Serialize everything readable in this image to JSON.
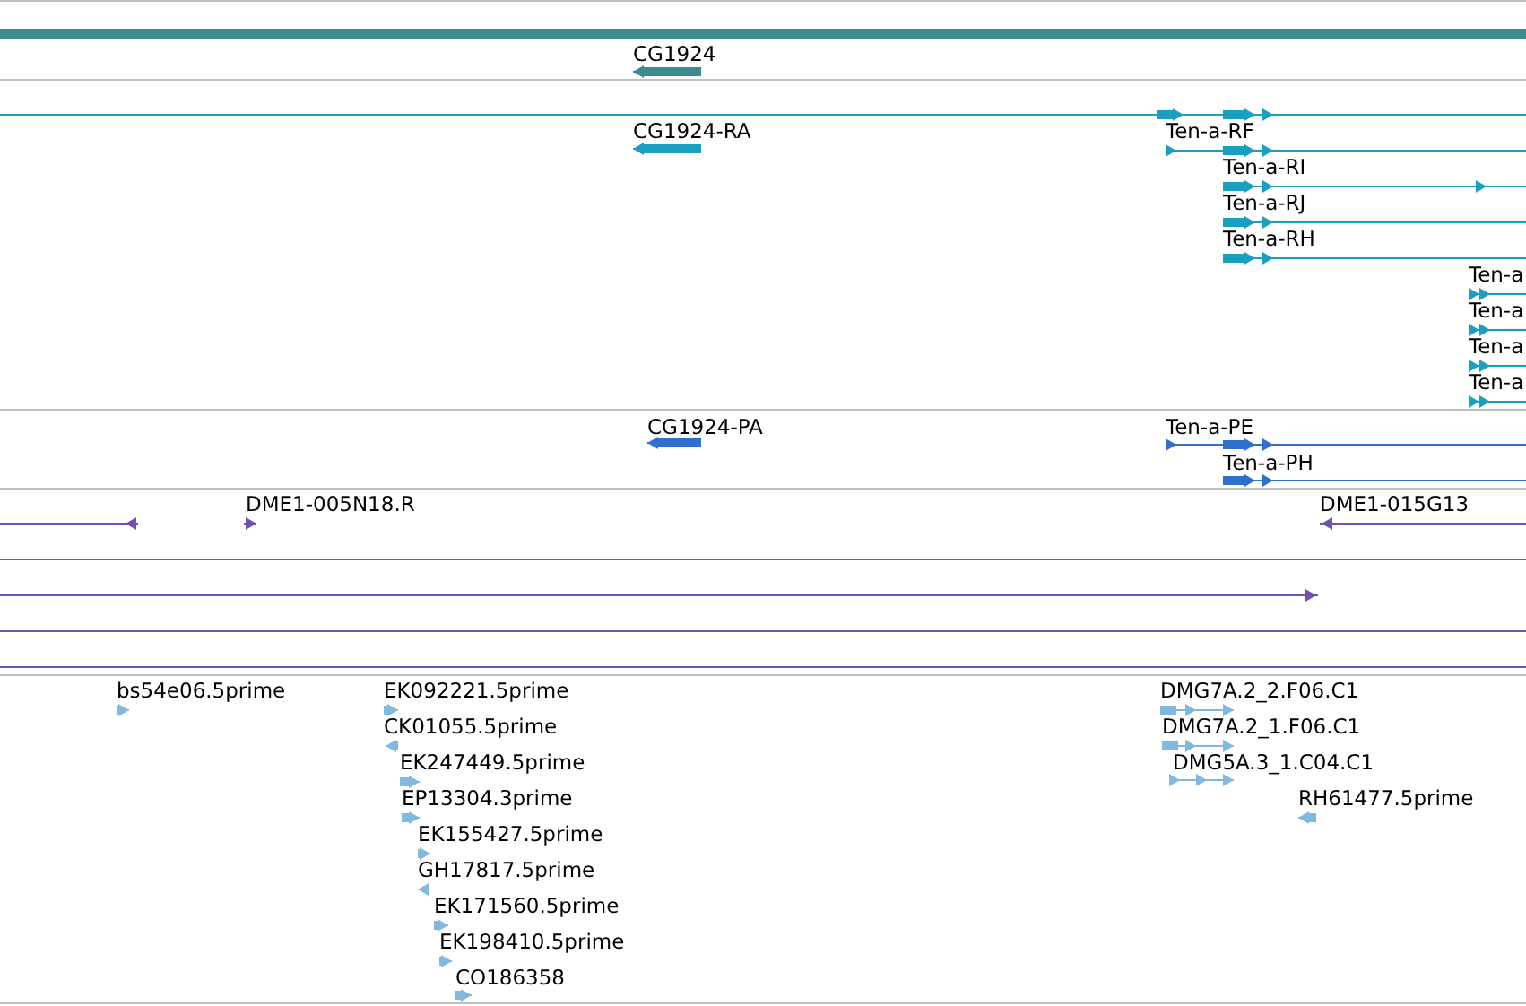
{
  "tracks": [
    {
      "color": "#3d8b8f",
      "features": [
        {
          "label": "CG1924",
          "reverse": true
        }
      ]
    },
    {
      "color": "#1a9fc0",
      "features": [
        {
          "label": "CG1924-RA",
          "reverse": true
        },
        {
          "label": "Ten-a-RF",
          "reverse": false
        },
        {
          "label": "Ten-a-RI",
          "reverse": false
        },
        {
          "label": "Ten-a-RJ",
          "reverse": false
        },
        {
          "label": "Ten-a-RH",
          "reverse": false
        },
        {
          "label": "Ten-a",
          "reverse": false
        },
        {
          "label": "Ten-a",
          "reverse": false
        },
        {
          "label": "Ten-a",
          "reverse": false
        },
        {
          "label": "Ten-a",
          "reverse": false
        }
      ]
    },
    {
      "color": "#2f6fd0",
      "features": [
        {
          "label": "CG1924-PA",
          "reverse": true
        },
        {
          "label": "Ten-a-PE",
          "reverse": false
        },
        {
          "label": "Ten-a-PH",
          "reverse": false
        }
      ]
    },
    {
      "color": "#7050b0",
      "features": [
        {
          "label": "DME1-005N18.R",
          "reverse": false
        },
        {
          "label": "DME1-015G13",
          "reverse": true
        }
      ]
    },
    {
      "color": "#80b8e0",
      "features": [
        {
          "label": "bs54e06.5prime",
          "reverse": false
        },
        {
          "label": "EK092221.5prime",
          "reverse": false
        },
        {
          "label": "CK01055.5prime",
          "reverse": true
        },
        {
          "label": "EK247449.5prime",
          "reverse": false
        },
        {
          "label": "EP13304.3prime",
          "reverse": false
        },
        {
          "label": "EK155427.5prime",
          "reverse": false
        },
        {
          "label": "GH17817.5prime",
          "reverse": true
        },
        {
          "label": "EK171560.5prime",
          "reverse": false
        },
        {
          "label": "EK198410.5prime",
          "reverse": false
        },
        {
          "label": "CO186358",
          "reverse": false
        },
        {
          "label": "DMG7A.2_2.F06.C1",
          "reverse": false
        },
        {
          "label": "DMG7A.2_1.F06.C1",
          "reverse": false
        },
        {
          "label": "DMG5A.3_1.C04.C1",
          "reverse": false
        },
        {
          "label": "RH61477.5prime",
          "reverse": true
        }
      ]
    }
  ]
}
